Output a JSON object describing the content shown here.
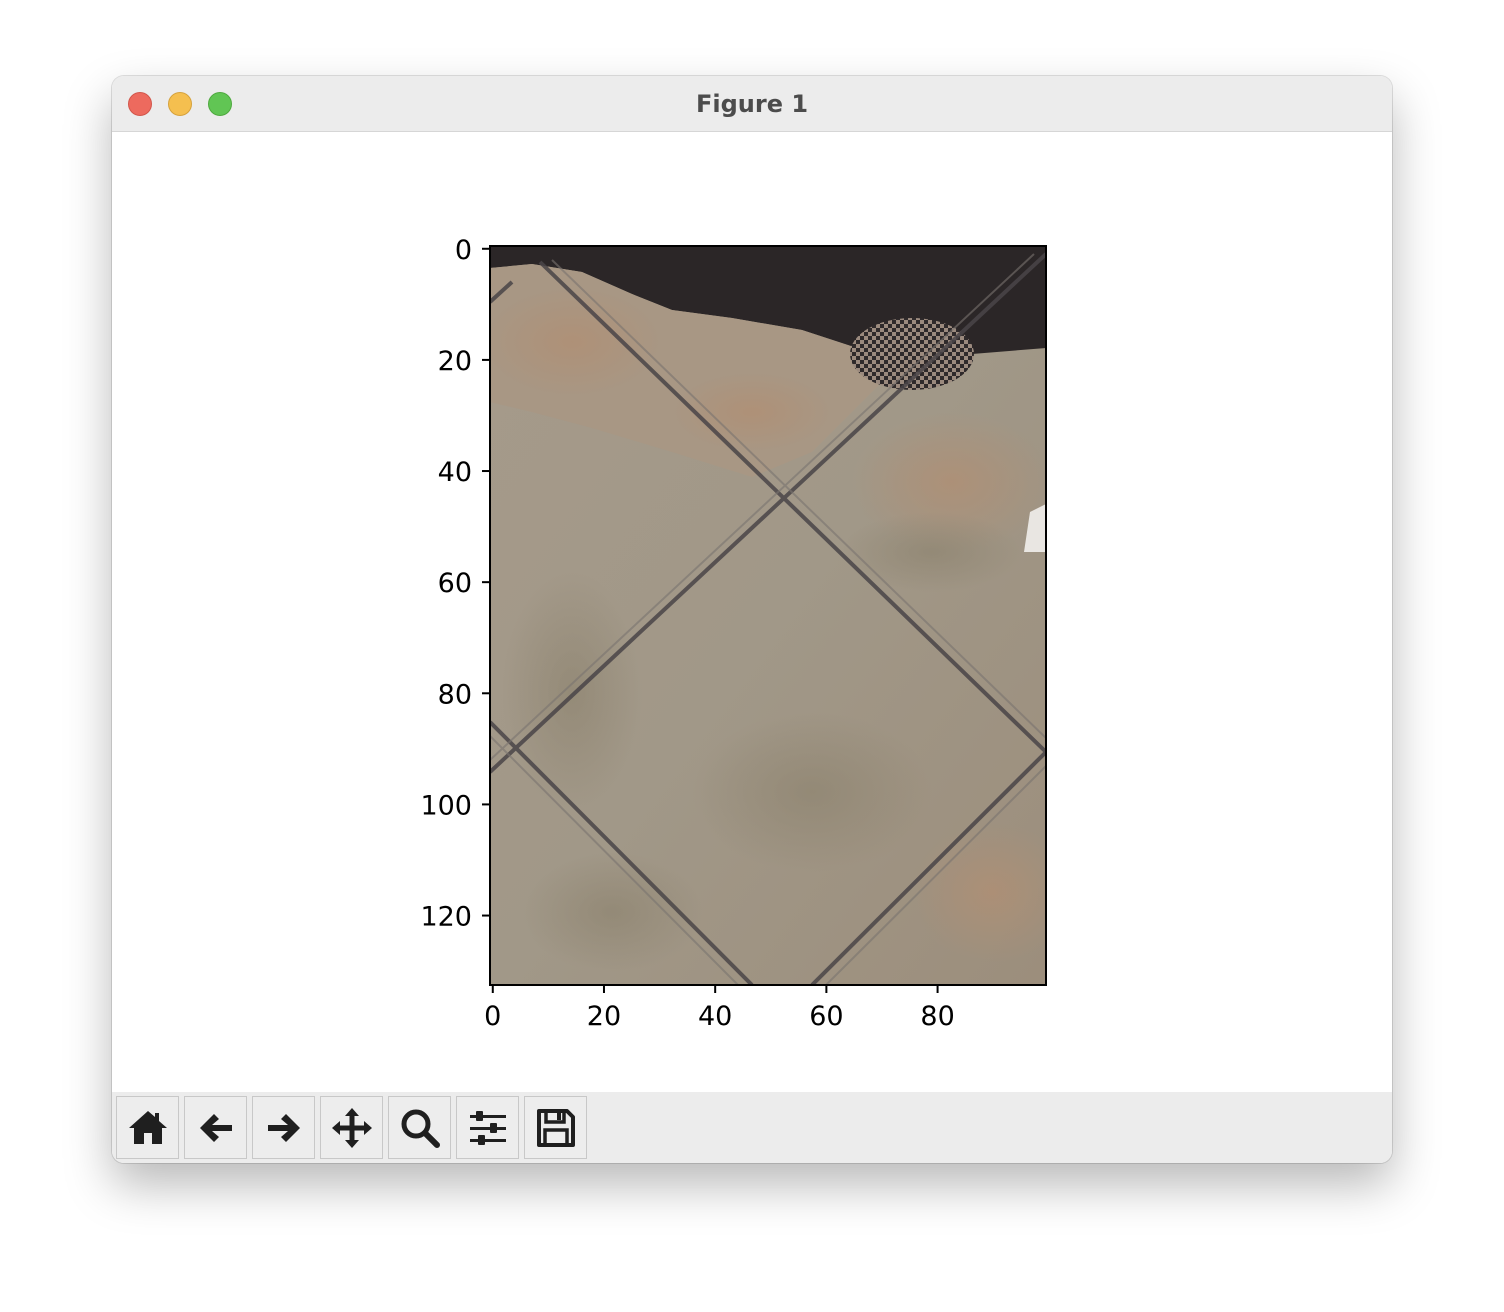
{
  "window": {
    "title": "Figure 1"
  },
  "toolbar": {
    "buttons": [
      {
        "name": "home",
        "icon": "home-icon"
      },
      {
        "name": "back",
        "icon": "arrow-left-icon"
      },
      {
        "name": "forward",
        "icon": "arrow-right-icon"
      },
      {
        "name": "pan",
        "icon": "move-icon"
      },
      {
        "name": "zoom",
        "icon": "magnifier-icon"
      },
      {
        "name": "configure-subplots",
        "icon": "sliders-icon"
      },
      {
        "name": "save",
        "icon": "floppy-disk-icon"
      }
    ]
  },
  "chart_data": {
    "type": "image",
    "title": "",
    "xlabel": "",
    "ylabel": "",
    "xlim": [
      -0.5,
      99.5
    ],
    "ylim": [
      132.5,
      -0.5
    ],
    "x_ticks": [
      0,
      20,
      40,
      60,
      80
    ],
    "y_ticks": [
      0,
      20,
      40,
      60,
      80,
      100,
      120
    ],
    "image_content": "photo of beige stone floor tiles with diagonal grout lines and a dark area along the top edge",
    "colors": {
      "dark": "#2a2527",
      "tile_light": "#a59a88",
      "tile_warm": "#a88e78",
      "grout": "#4a4648"
    }
  }
}
